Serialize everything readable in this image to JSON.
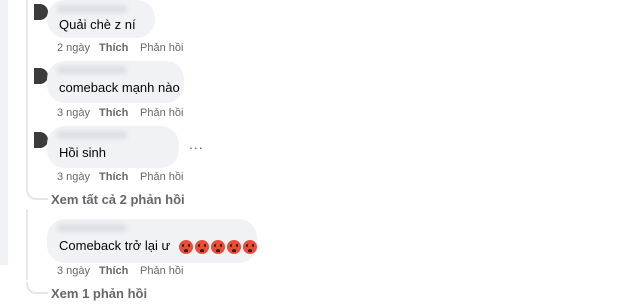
{
  "comments": [
    {
      "text": "Quải chè z ní",
      "time": "2 ngày",
      "like": "Thích",
      "reply": "Phản hồi"
    },
    {
      "text": "comeback mạnh nào",
      "time": "3 ngày",
      "like": "Thích",
      "reply": "Phản hồi"
    },
    {
      "text": "Hồi sinh",
      "time": "3 ngày",
      "like": "Thích",
      "reply": "Phản hồi",
      "more": "..."
    },
    {
      "text": "Comeback trở lại ư",
      "time": "3 ngày",
      "like": "Thích",
      "reply": "Phản hồi",
      "emoji": "pouting-face-emoji"
    }
  ],
  "view_more_1": "Xem tất cả 2 phản hồi",
  "view_more_2": "Xem 1 phản hồi",
  "colors": {
    "bubble": "#f0f2f5",
    "meta": "#65676b",
    "emoji": "#e94d3a"
  }
}
